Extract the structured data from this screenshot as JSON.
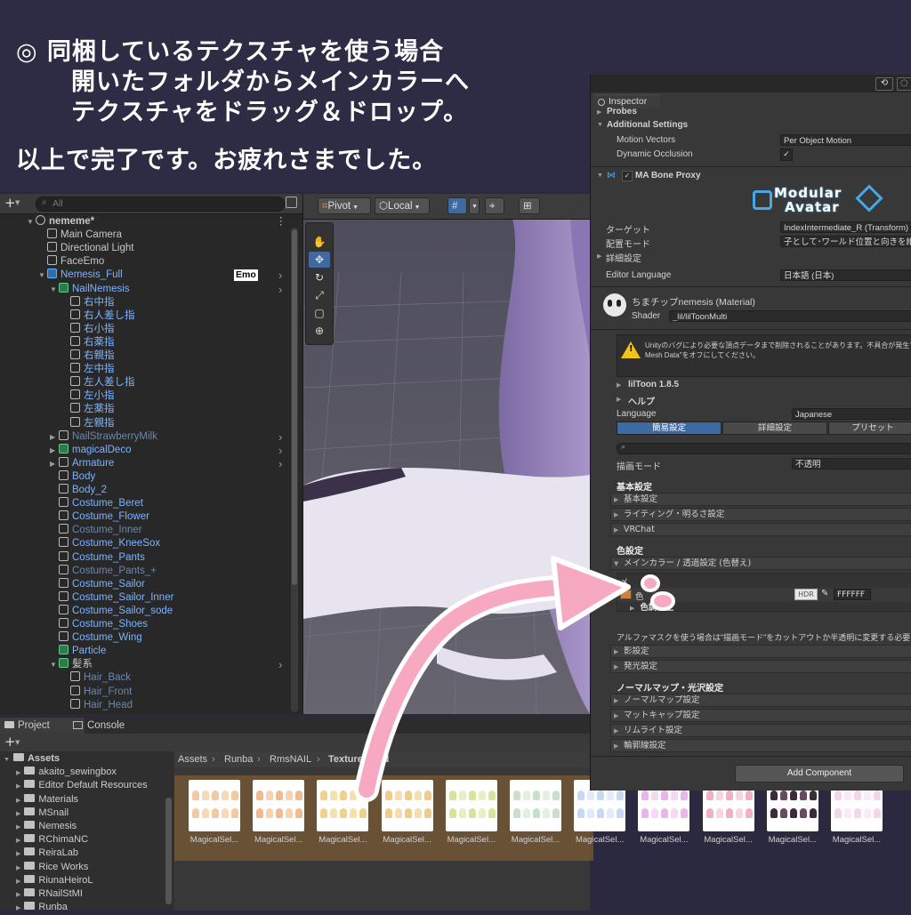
{
  "banner": {
    "line1": "◎ 同梱しているテクスチャを使う場合",
    "line2": "開いたフォルダからメインカラーへ",
    "line3": "テクスチャをドラッグ＆ドロップ。",
    "line4": "以上で完了です。お疲れさまでした。"
  },
  "hierarchy": {
    "search_placeholder": "All",
    "add_label": "+",
    "items": [
      {
        "label": "nememe*",
        "indent": 0,
        "style": "bold",
        "arrow": "▼"
      },
      {
        "label": "Main Camera",
        "indent": 1,
        "style": "normal"
      },
      {
        "label": "Directional Light",
        "indent": 1,
        "style": "normal"
      },
      {
        "label": "FaceEmo",
        "indent": 1,
        "style": "normal"
      },
      {
        "label": "Nemesis_Full",
        "indent": 1,
        "style": "blue",
        "arrow": "▼",
        "badge": "Emo"
      },
      {
        "label": "NailNemesis",
        "indent": 2,
        "style": "blue",
        "arrow": "▼"
      },
      {
        "label": "右中指",
        "indent": 3,
        "style": "blue"
      },
      {
        "label": "右人差し指",
        "indent": 3,
        "style": "blue"
      },
      {
        "label": "右小指",
        "indent": 3,
        "style": "blue"
      },
      {
        "label": "右薬指",
        "indent": 3,
        "style": "blue"
      },
      {
        "label": "右親指",
        "indent": 3,
        "style": "blue"
      },
      {
        "label": "左中指",
        "indent": 3,
        "style": "blue"
      },
      {
        "label": "左人差し指",
        "indent": 3,
        "style": "blue"
      },
      {
        "label": "左小指",
        "indent": 3,
        "style": "blue"
      },
      {
        "label": "左薬指",
        "indent": 3,
        "style": "blue"
      },
      {
        "label": "左親指",
        "indent": 3,
        "style": "blue"
      },
      {
        "label": "NailStrawberryMilk",
        "indent": 2,
        "style": "dim",
        "arrow": "▶"
      },
      {
        "label": "magicalDeco",
        "indent": 2,
        "style": "blue",
        "arrow": "▶"
      },
      {
        "label": "Armature",
        "indent": 2,
        "style": "blue",
        "arrow": "▶"
      },
      {
        "label": "Body",
        "indent": 2,
        "style": "blue"
      },
      {
        "label": "Body_2",
        "indent": 2,
        "style": "blue"
      },
      {
        "label": "Costume_Beret",
        "indent": 2,
        "style": "blue"
      },
      {
        "label": "Costume_Flower",
        "indent": 2,
        "style": "blue"
      },
      {
        "label": "Costume_Inner",
        "indent": 2,
        "style": "dim"
      },
      {
        "label": "Costume_KneeSox",
        "indent": 2,
        "style": "blue"
      },
      {
        "label": "Costume_Pants",
        "indent": 2,
        "style": "blue"
      },
      {
        "label": "Costume_Pants_+",
        "indent": 2,
        "style": "dim"
      },
      {
        "label": "Costume_Sailor",
        "indent": 2,
        "style": "blue"
      },
      {
        "label": "Costume_Sailor_Inner",
        "indent": 2,
        "style": "blue"
      },
      {
        "label": "Costume_Sailor_sode",
        "indent": 2,
        "style": "blue"
      },
      {
        "label": "Costume_Shoes",
        "indent": 2,
        "style": "blue"
      },
      {
        "label": "Costume_Wing",
        "indent": 2,
        "style": "blue"
      },
      {
        "label": "Particle",
        "indent": 2,
        "style": "blue"
      },
      {
        "label": "髪系",
        "indent": 2,
        "style": "normal",
        "arrow": "▼"
      },
      {
        "label": "Hair_Back",
        "indent": 3,
        "style": "dim"
      },
      {
        "label": "Hair_Front",
        "indent": 3,
        "style": "dim"
      },
      {
        "label": "Hair_Head",
        "indent": 3,
        "style": "dim"
      }
    ]
  },
  "scene": {
    "pivot": "Pivot",
    "local": "Local"
  },
  "inspector": {
    "tab": "Inspector",
    "probes": "Probes",
    "additional_settings": "Additional Settings",
    "motion_vectors": "Motion Vectors",
    "motion_vectors_value": "Per Object Motion",
    "dynamic_occlusion": "Dynamic Occlusion",
    "ma_bone_proxy": "MA Bone Proxy",
    "logo_line1": "Modular",
    "logo_line2": "Avatar",
    "target": "ターゲット",
    "target_value": "IndexIntermediate_R (Transform)",
    "placement_mode": "配置モード",
    "placement_value": "子として･ワールド位置と向きを維持",
    "details": "詳細設定",
    "editor_language": "Editor Language",
    "editor_language_value": "日本語 (日本)",
    "material_name": "ちまチップnemesis (Material)",
    "shader_label": "Shader",
    "shader_value": "_lil/lilToonMulti",
    "warning_line1": "Unityのバグにより必要な頂点データまで削除されることがあります。不具合が発生する場合は",
    "warning_line2": "Mesh Data\"をオフにしてください。",
    "liltoon_version": "lilToon 1.8.5",
    "help": "ヘルプ",
    "language": "Language",
    "language_value": "Japanese",
    "tabs": [
      "簡易設定",
      "詳細設定",
      "プリセット"
    ],
    "render_mode": "描画モード",
    "render_mode_value": "不透明",
    "basic_header": "基本設定",
    "basic_items": [
      "基本設定",
      "ライティング・明るさ設定",
      "VRChat"
    ],
    "color_header": "色設定",
    "main_color_section": "メインカラー / 透過設定 (色替え)",
    "main_color_short": "メ",
    "color_label": "色",
    "hdr": "HDR",
    "hex": "FFFFFF",
    "color_correction": "色調補正",
    "alpha_note": "アルファマスクを使う場合は\"描画モード\"をカットアウトか半透明に変更する必要があります",
    "color_items": [
      "影設定",
      "発光設定"
    ],
    "normal_header": "ノーマルマップ・光沢設定",
    "normal_items": [
      "ノーマルマップ設定",
      "マットキャップ設定",
      "リムライト設定",
      "輪郭線設定"
    ],
    "add_component": "Add Component"
  },
  "project": {
    "tab_project": "Project",
    "tab_console": "Console",
    "add_label": "+",
    "tree": [
      {
        "label": "Assets",
        "indent": 0,
        "bold": true
      },
      {
        "label": "akaito_sewingbox",
        "indent": 1
      },
      {
        "label": "Editor Default Resources",
        "indent": 1
      },
      {
        "label": "Materials",
        "indent": 1
      },
      {
        "label": "MSnail",
        "indent": 1
      },
      {
        "label": "Nemesis",
        "indent": 1
      },
      {
        "label": "RChimaNC",
        "indent": 1
      },
      {
        "label": "ReiraLab",
        "indent": 1
      },
      {
        "label": "Rice Works",
        "indent": 1
      },
      {
        "label": "RiunaHeiroL",
        "indent": 1
      },
      {
        "label": "RNailStMI",
        "indent": 1
      },
      {
        "label": "Runba",
        "indent": 1
      }
    ],
    "breadcrumb": [
      "Assets",
      "Runba",
      "RmsNAIL",
      "Texture_NSN"
    ],
    "thumb_label": "MagicalSel..."
  },
  "colors": {
    "arrow": "#f7a9c2",
    "selection": "#7a5a36",
    "accent_blue": "#3d6aa3"
  }
}
